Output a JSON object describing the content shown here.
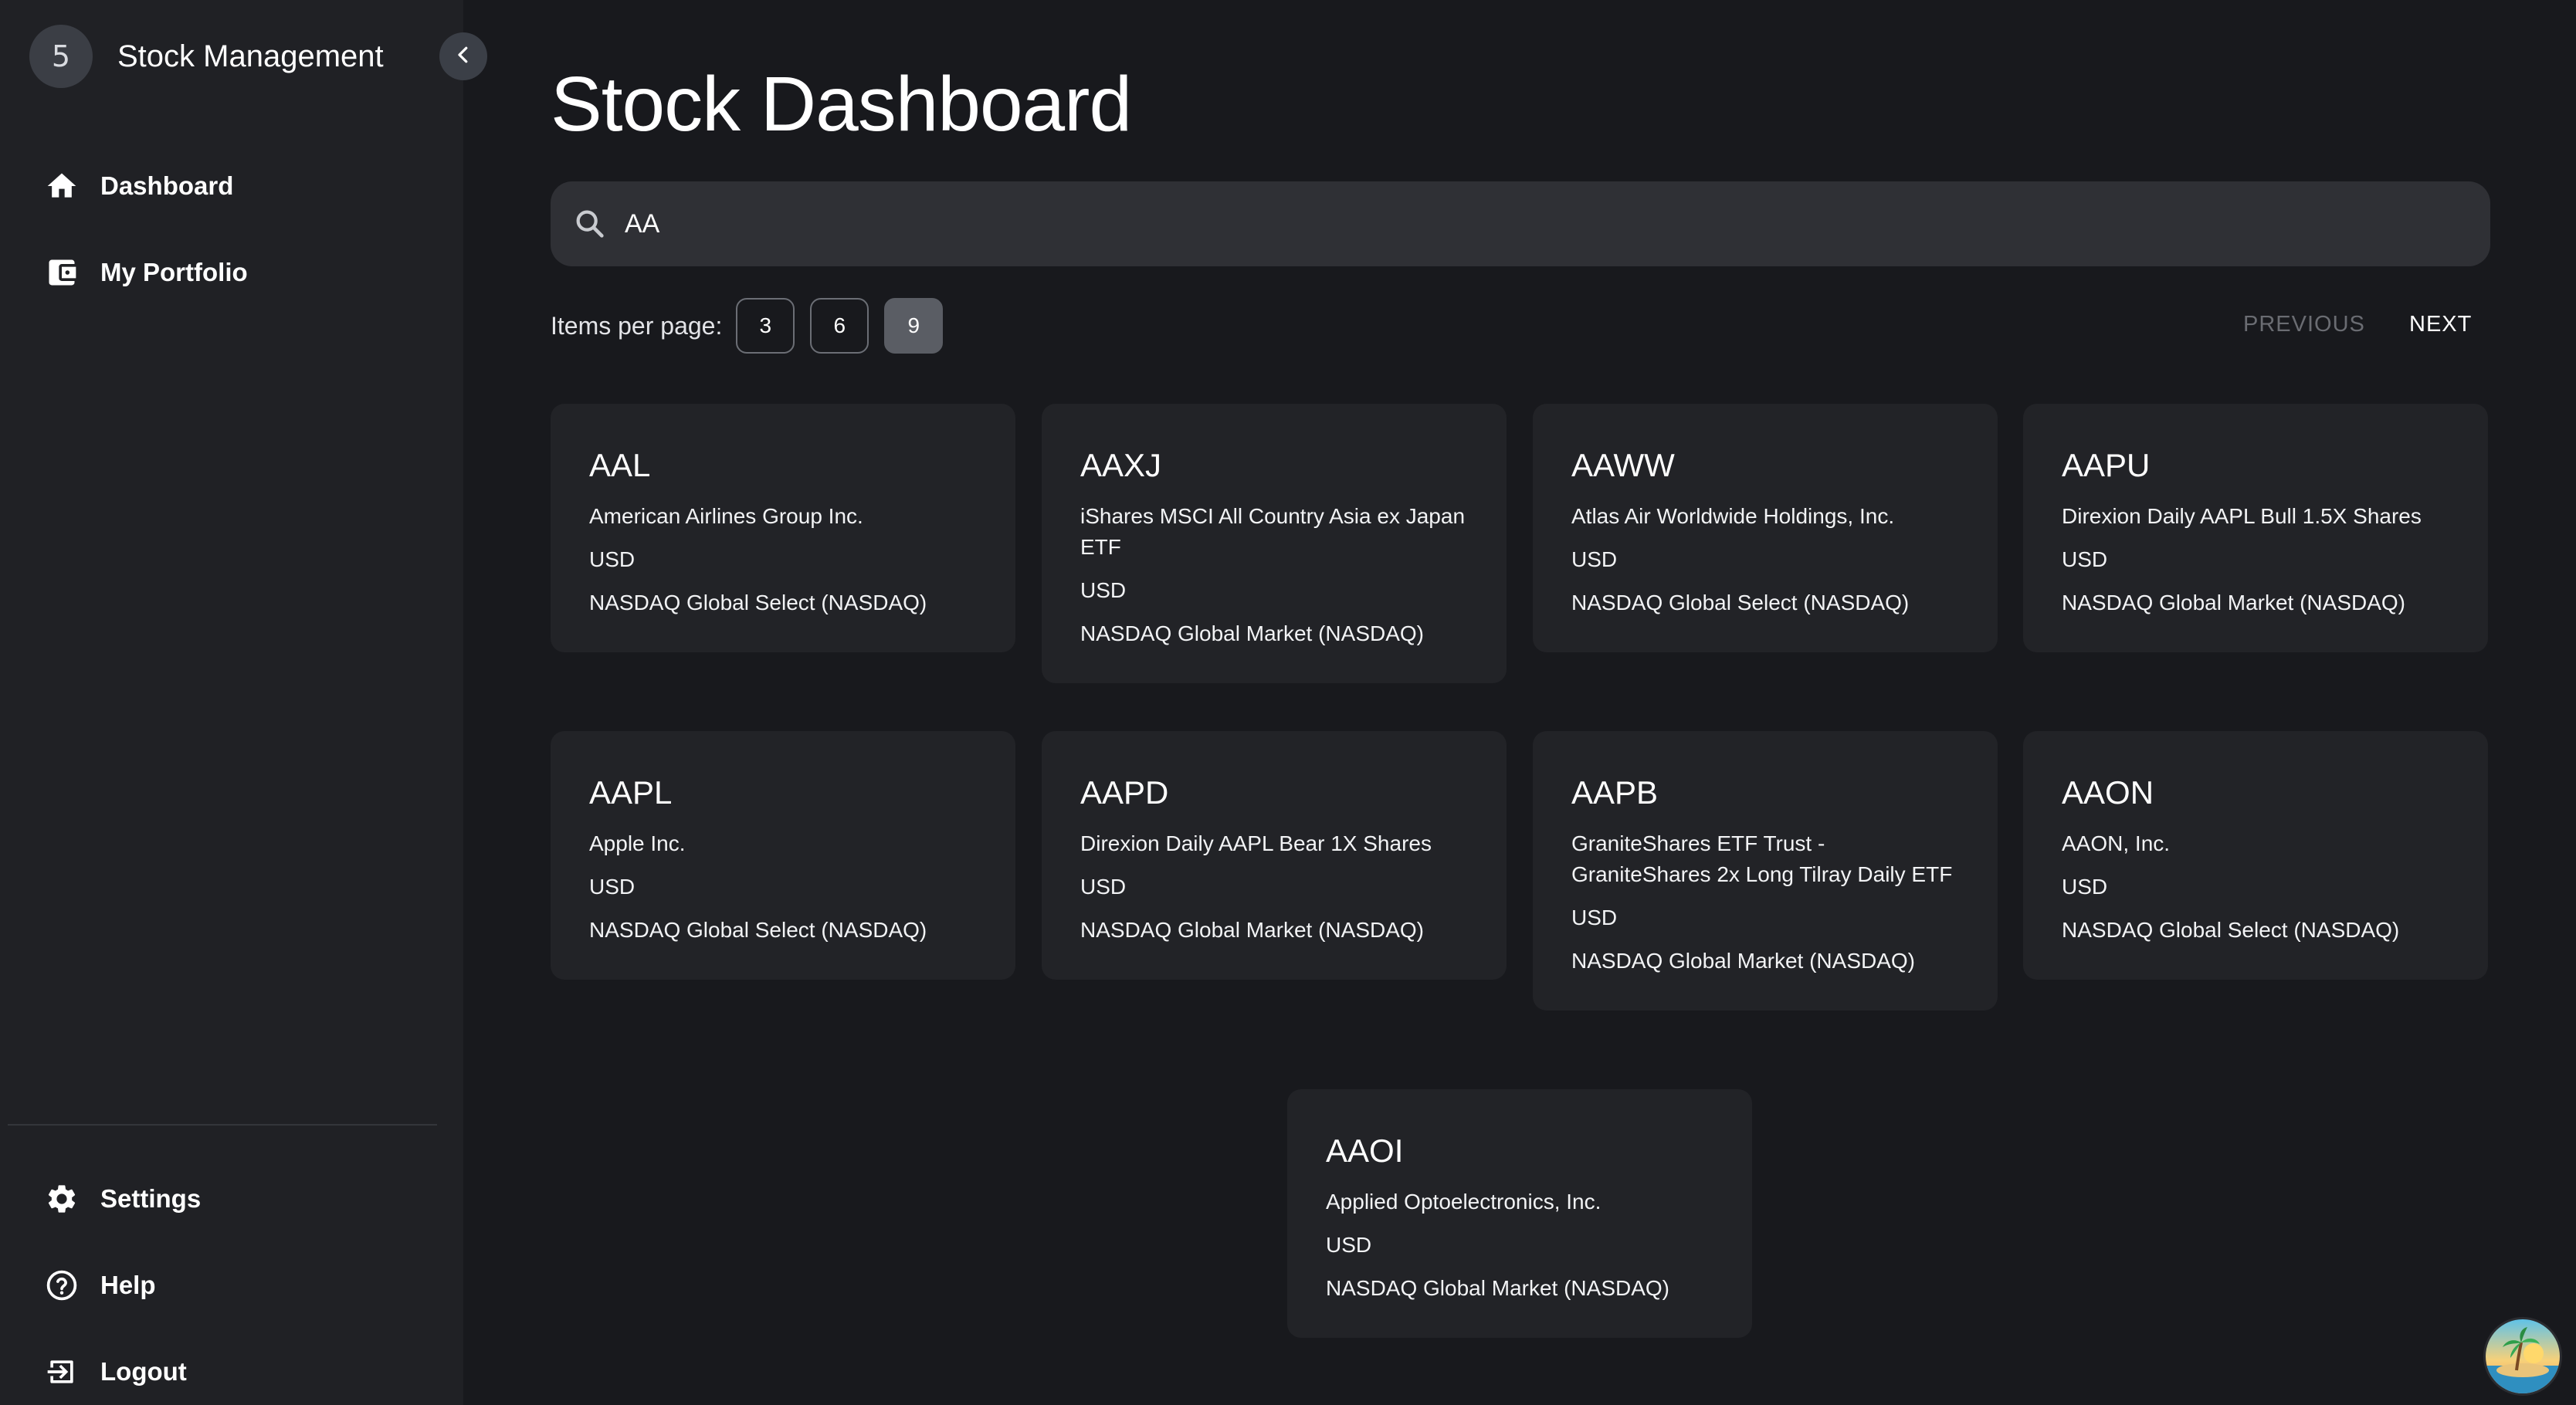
{
  "sidebar": {
    "logo_char": "5",
    "brand": "Stock Management",
    "nav": [
      {
        "label": "Dashboard",
        "icon": "home-icon"
      },
      {
        "label": "My Portfolio",
        "icon": "wallet-icon"
      }
    ],
    "bottom": [
      {
        "label": "Settings",
        "icon": "gear-icon"
      },
      {
        "label": "Help",
        "icon": "help-circle-icon"
      },
      {
        "label": "Logout",
        "icon": "logout-icon"
      }
    ]
  },
  "main": {
    "title": "Stock Dashboard",
    "search_value": "AA",
    "items_per_page_label": "Items per page:",
    "page_sizes": [
      "3",
      "6",
      "9"
    ],
    "active_page_size": "9",
    "previous_label": "PREVIOUS",
    "next_label": "NEXT",
    "stocks": [
      {
        "symbol": "AAL",
        "name": "American Airlines Group Inc.",
        "currency": "USD",
        "exchange": "NASDAQ Global Select (NASDAQ)"
      },
      {
        "symbol": "AAXJ",
        "name": "iShares MSCI All Country Asia ex Japan ETF",
        "currency": "USD",
        "exchange": "NASDAQ Global Market (NASDAQ)"
      },
      {
        "symbol": "AAWW",
        "name": "Atlas Air Worldwide Holdings, Inc.",
        "currency": "USD",
        "exchange": "NASDAQ Global Select (NASDAQ)"
      },
      {
        "symbol": "AAPU",
        "name": "Direxion Daily AAPL Bull 1.5X Shares",
        "currency": "USD",
        "exchange": "NASDAQ Global Market (NASDAQ)"
      },
      {
        "symbol": "AAPL",
        "name": "Apple Inc.",
        "currency": "USD",
        "exchange": "NASDAQ Global Select (NASDAQ)"
      },
      {
        "symbol": "AAPD",
        "name": "Direxion Daily AAPL Bear 1X Shares",
        "currency": "USD",
        "exchange": "NASDAQ Global Market (NASDAQ)"
      },
      {
        "symbol": "AAPB",
        "name": "GraniteShares ETF Trust - GraniteShares 2x Long Tilray Daily ETF",
        "currency": "USD",
        "exchange": "NASDAQ Global Market (NASDAQ)"
      },
      {
        "symbol": "AAON",
        "name": "AAON, Inc.",
        "currency": "USD",
        "exchange": "NASDAQ Global Select (NASDAQ)"
      },
      {
        "symbol": "AAOI",
        "name": "Applied Optoelectronics, Inc.",
        "currency": "USD",
        "exchange": "NASDAQ Global Market (NASDAQ)"
      }
    ]
  },
  "colors": {
    "background": "#18191d",
    "sidebar": "#202125",
    "card": "#222327",
    "search": "#2f3035",
    "active_page_size": "#5a5d64"
  }
}
